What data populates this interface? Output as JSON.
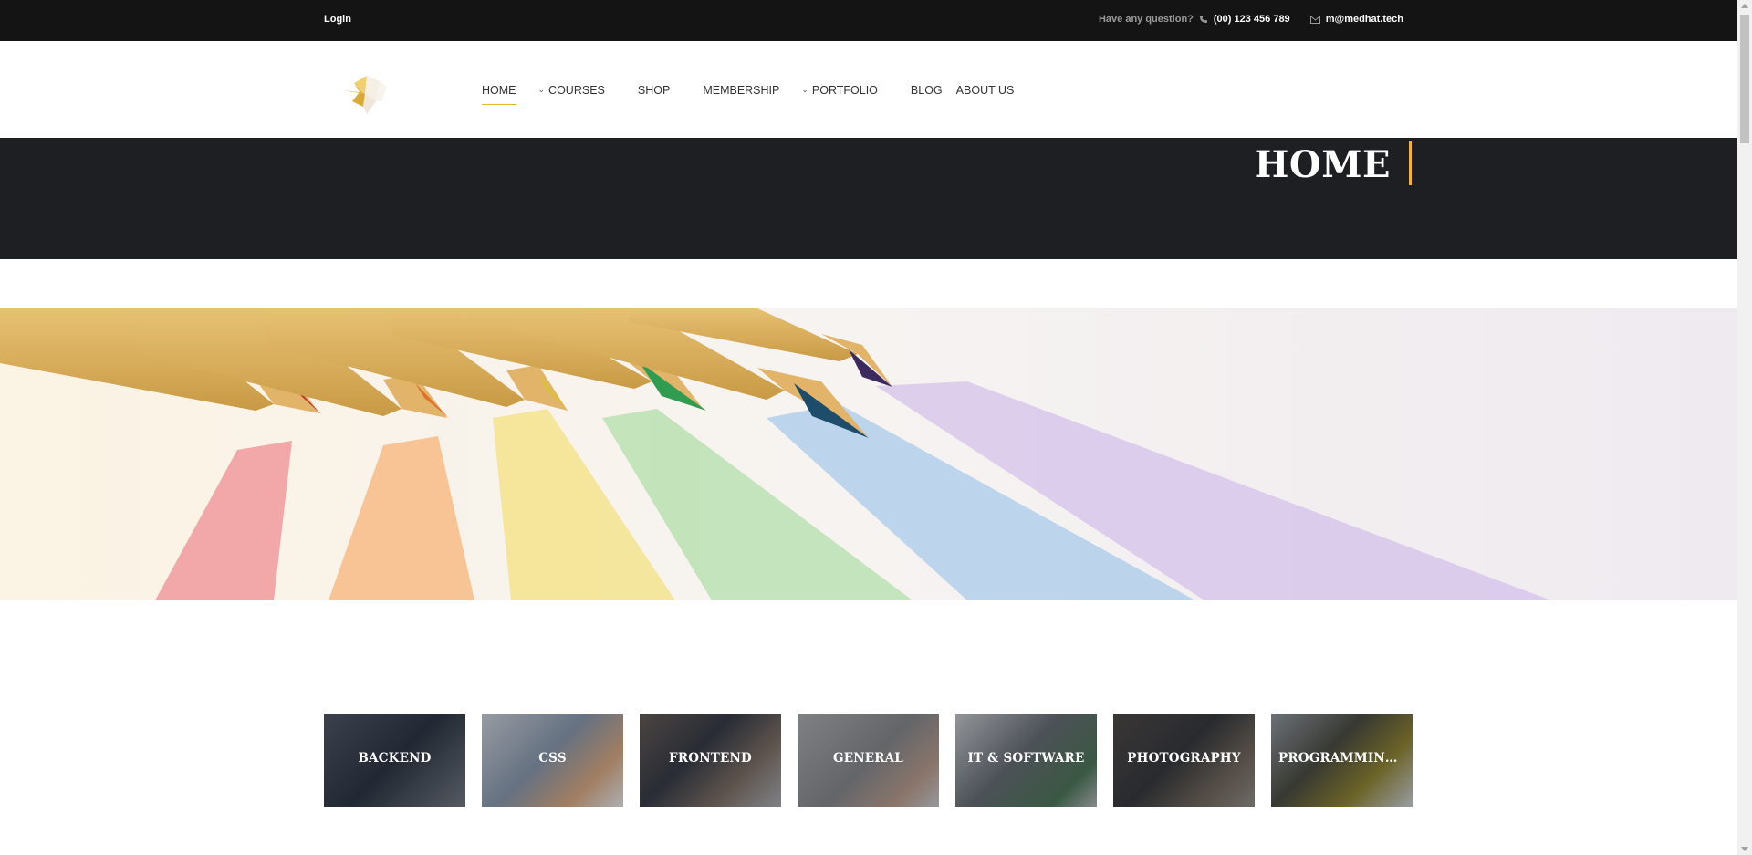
{
  "topbar": {
    "login": "Login",
    "question": "Have any question?",
    "phone": "(00) 123 456 789",
    "email": "m@medhat.tech"
  },
  "nav": {
    "items": [
      {
        "label": "HOME",
        "active": true,
        "dropdown": false
      },
      {
        "label": "COURSES",
        "active": false,
        "dropdown": true
      },
      {
        "label": "SHOP",
        "active": false,
        "dropdown": false
      },
      {
        "label": "MEMBERSHIP",
        "active": false,
        "dropdown": false
      },
      {
        "label": "PORTFOLIO",
        "active": false,
        "dropdown": true
      },
      {
        "label": "BLOG",
        "active": false,
        "dropdown": false
      },
      {
        "label": "ABOUT US",
        "active": false,
        "dropdown": false
      }
    ]
  },
  "page_title": "HOME",
  "categories": [
    {
      "label": "BACKEND"
    },
    {
      "label": "CSS"
    },
    {
      "label": "FRONTEND"
    },
    {
      "label": "GENERAL"
    },
    {
      "label": "IT & SOFTWARE"
    },
    {
      "label": "PHOTOGRAPHY"
    },
    {
      "label": "PROGRAMMING L..."
    }
  ],
  "icons": {
    "phone": "phone-icon",
    "mail": "mail-icon",
    "dropdown": "chevron-down-icon",
    "logo": "bird-logo-icon"
  },
  "colors": {
    "topbar_bg": "#141414",
    "title_band_bg": "#1e1f23",
    "accent": "#f2b233",
    "nav_text": "#333333"
  }
}
